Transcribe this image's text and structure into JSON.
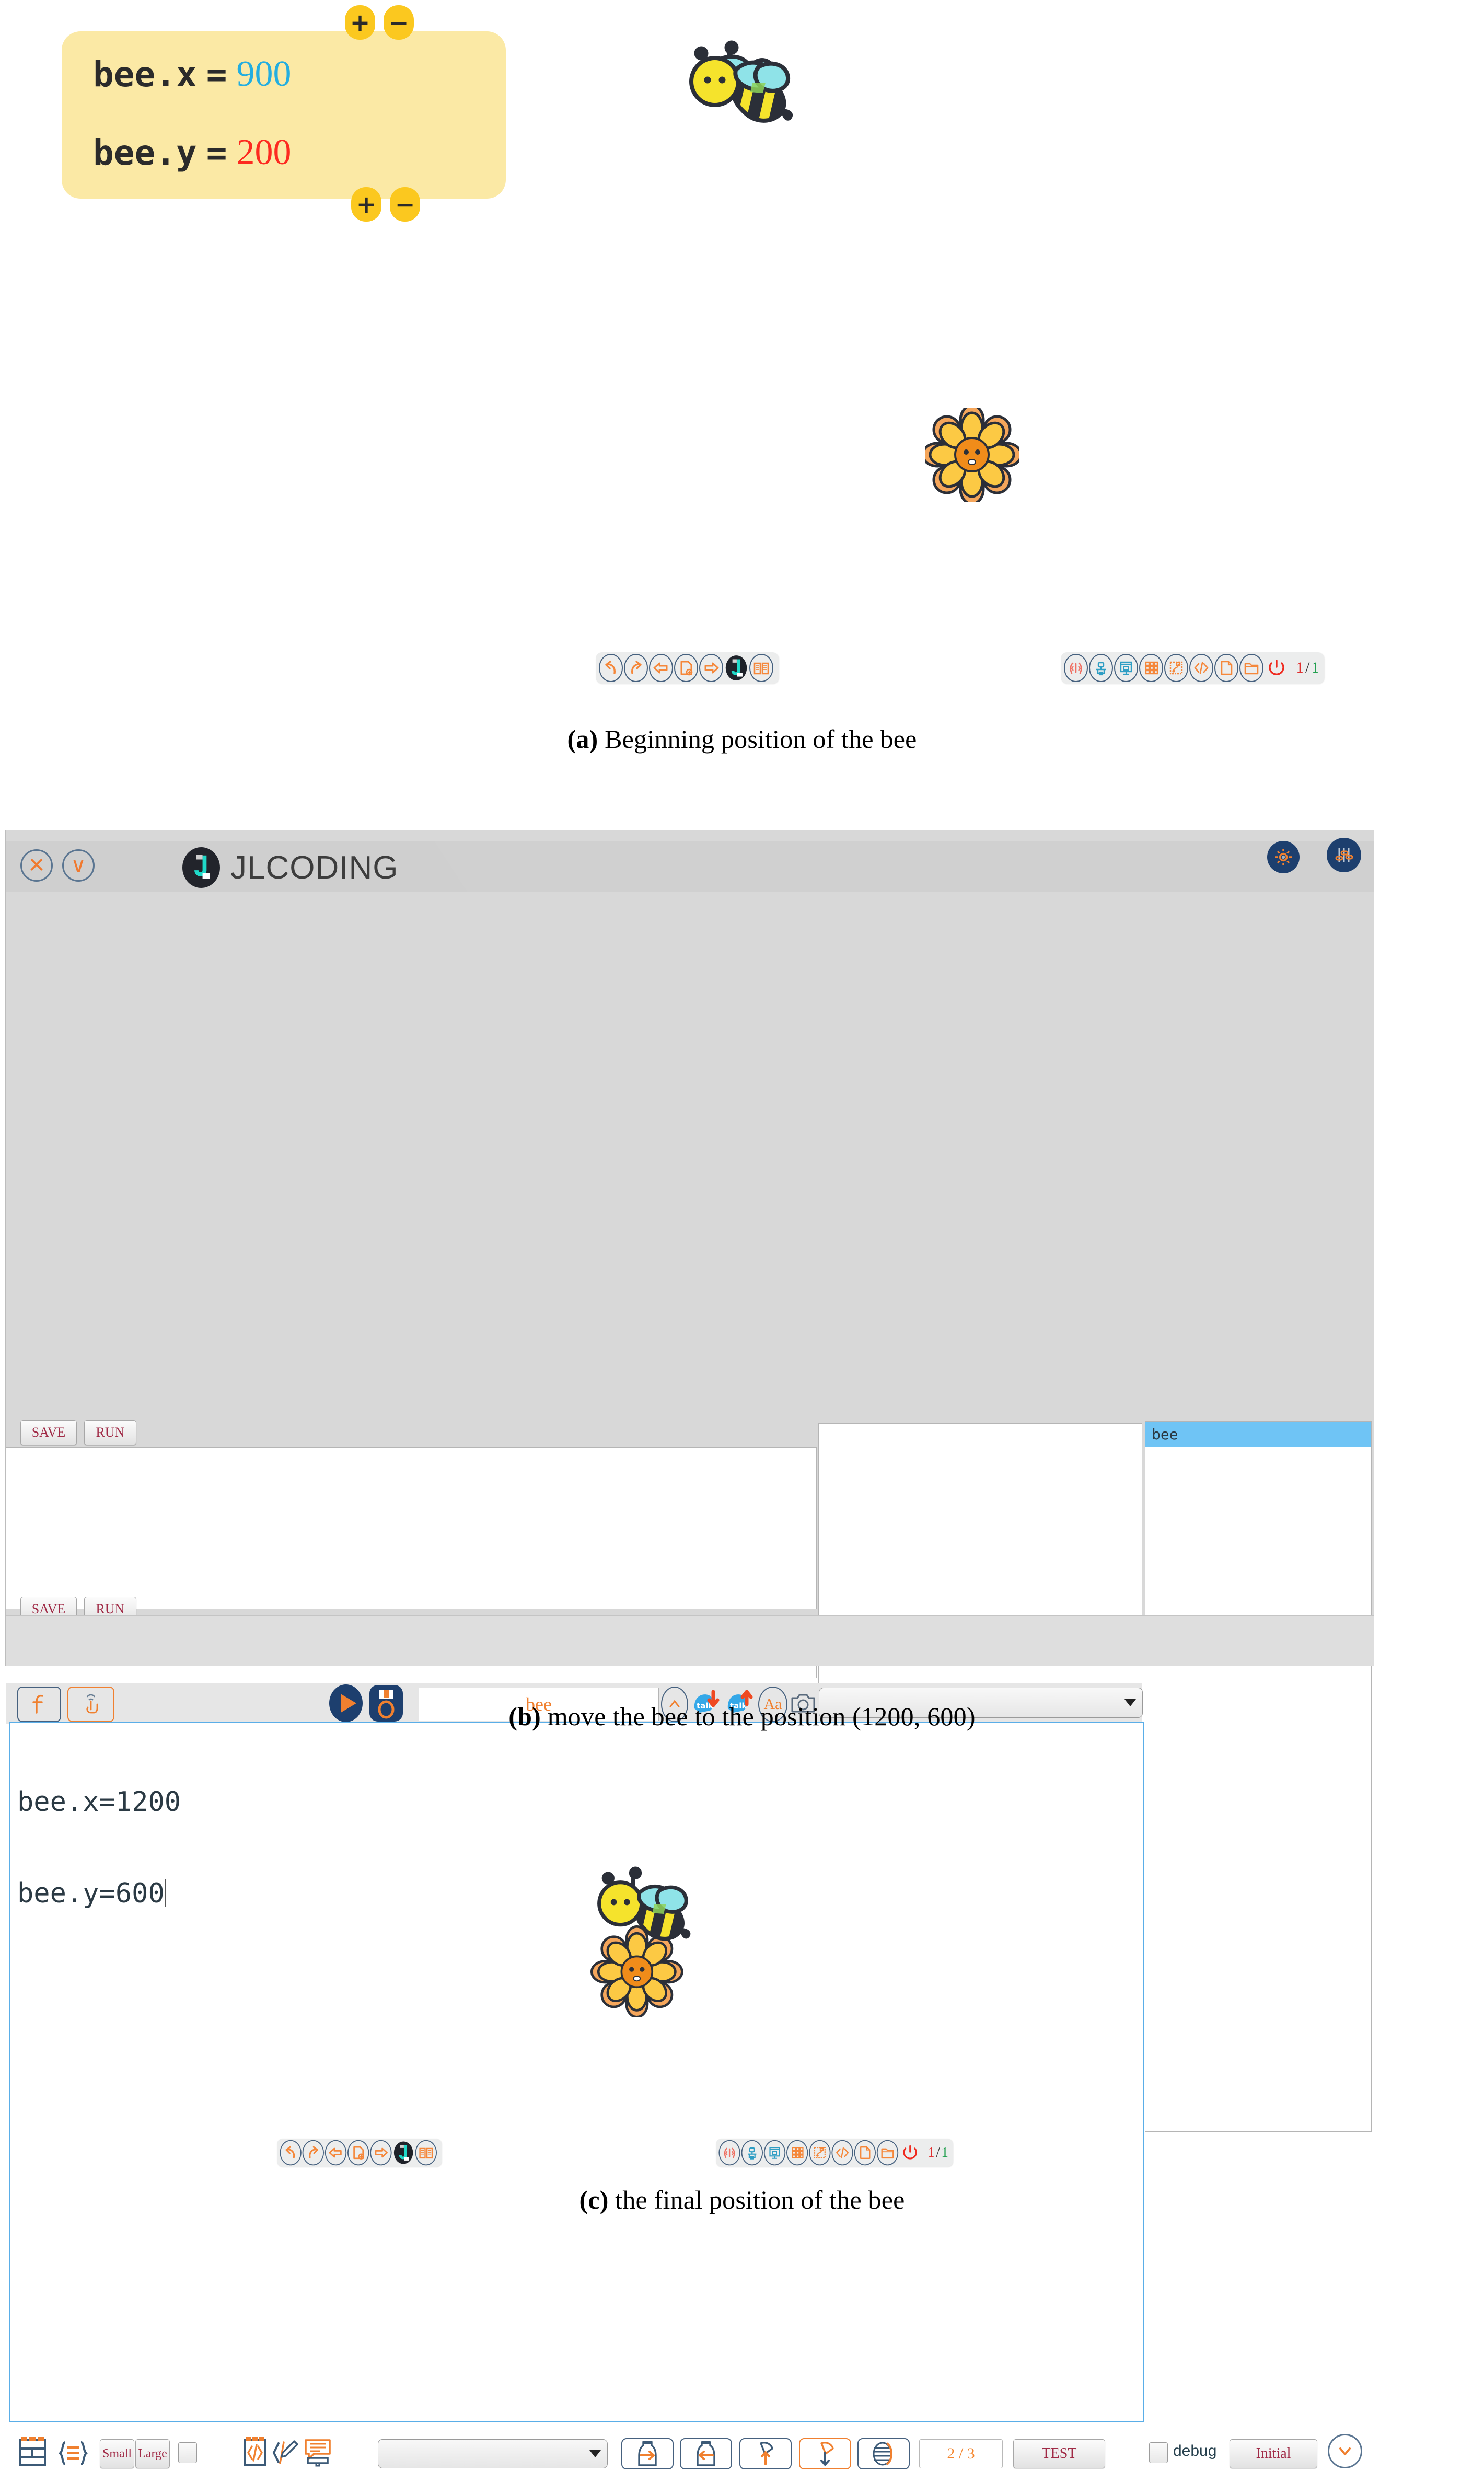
{
  "figure": {
    "captions": {
      "a": {
        "prefix": "(a)",
        "text": "Beginning position of the bee"
      },
      "b": {
        "prefix": "(b)",
        "text": "move the bee to the position (1200, 600)"
      },
      "c": {
        "prefix": "(c)",
        "text": "the final position of the bee"
      }
    }
  },
  "code_bubble": {
    "lines": [
      {
        "name": "bee.x",
        "eq": "=",
        "value": "900",
        "value_color": "#23aee0"
      },
      {
        "name": "bee.y",
        "eq": "=",
        "value": "200",
        "value_color": "#fd2a20"
      }
    ],
    "plus_label": "+",
    "minus_label": "−",
    "background": "#fbe9a5",
    "button_color": "#fbc81f"
  },
  "sprites": {
    "bee_name": "bee",
    "flower_name": "flower"
  },
  "toolbar_left": {
    "items": [
      {
        "icon": "undo-arrow-icon",
        "label": ""
      },
      {
        "icon": "redo-arrow-icon",
        "label": ""
      },
      {
        "icon": "back-arrow-icon",
        "label": ""
      },
      {
        "icon": "page-add-icon",
        "label": ""
      },
      {
        "icon": "forward-arrow-icon",
        "label": ""
      },
      {
        "icon": "jlcoding-logo-icon",
        "label": ""
      },
      {
        "icon": "book-icon",
        "label": ""
      }
    ]
  },
  "toolbar_right": {
    "items": [
      {
        "icon": "hands-code-icon",
        "label": ""
      },
      {
        "icon": "robot-blue-icon",
        "label": ""
      },
      {
        "icon": "presentation-icon",
        "label": ""
      },
      {
        "icon": "keypad-grid-icon",
        "label": ""
      },
      {
        "icon": "flowchart-icon",
        "label": ""
      },
      {
        "icon": "code-brackets-icon",
        "label": ""
      },
      {
        "icon": "document-icon",
        "label": ""
      },
      {
        "icon": "folder-icon",
        "label": ""
      },
      {
        "icon": "power-icon",
        "label": ""
      }
    ],
    "page_current": "1",
    "page_separator": "/",
    "page_total": "1"
  },
  "window": {
    "title": "JLCODING",
    "close_label": "✕",
    "minimize_label": "∨",
    "header_icons": [
      {
        "icon": "gear-icon"
      },
      {
        "icon": "sliders-icon"
      }
    ],
    "editor_top": {
      "save_label": "SAVE",
      "run_label": "RUN"
    },
    "editor_mid": {
      "save_label": "SAVE",
      "run_label": "RUN"
    },
    "code_toolbar": {
      "function_icon": "function-f-icon",
      "touch_icon": "touch-gesture-icon",
      "run_icon": "play-run-icon",
      "save_icon": "floppy-save-icon",
      "object_name": "bee",
      "caret_icon": "caret-up-icon",
      "talk_down_icon": "talk-down-icon",
      "talk_up_icon": "talk-up-icon",
      "font_icon": "font-aa-icon",
      "camera_icon": "camera-icon",
      "dropdown_value": ""
    },
    "code_editor": {
      "lines": [
        "bee.x=1200",
        "bee.y=600"
      ]
    },
    "object_list": {
      "selected": "bee",
      "items": [
        "bee"
      ]
    },
    "statusbar": {
      "layout_icon": "layout-grid-icon",
      "braces_icon": "braces-list-icon",
      "small_label": "Small",
      "large_label": "Large",
      "checkbox_checked": false,
      "code_icon": "code-page-icon",
      "edit_code_icon": "code-pen-icon",
      "speech_icon": "speech-print-icon",
      "dropdown_value": "",
      "jar_right_icon": "jar-arrow-right-icon",
      "jar_left_icon": "jar-arrow-left-icon",
      "jar_up_icon": "jar-arrow-up-icon",
      "jar_down_icon": "jar-arrow-down-icon",
      "contrast_icon": "contrast-icon",
      "page_indicator": "2 / 3",
      "test_label": "TEST",
      "debug_label": "debug",
      "debug_checked": false,
      "initial_label": "Initial",
      "expand_icon": "chevron-down-circle-icon"
    }
  }
}
